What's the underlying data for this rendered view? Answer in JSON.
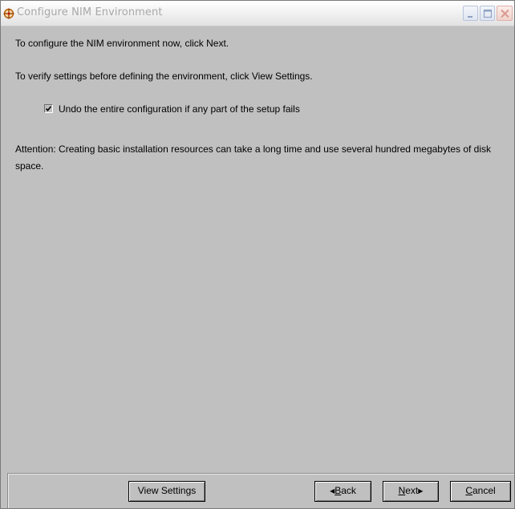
{
  "window": {
    "title": "Configure NIM Environment"
  },
  "content": {
    "line1": "To configure the NIM environment now, click Next.",
    "line2": "To verify settings before defining the environment,  click View Settings.",
    "checkbox": {
      "label": "Undo the entire configuration if any part of the setup fails",
      "checked": true
    },
    "attention": "Attention:  Creating basic installation resources can take a long time and use several hundred megabytes of disk space."
  },
  "buttons": {
    "view_settings": "View Settings",
    "back": {
      "arrow": "◀",
      "mnemonic": "B",
      "rest": "ack"
    },
    "next": {
      "mnemonic": "N",
      "rest": "ext",
      "arrow": "▶"
    },
    "cancel": {
      "mnemonic": "C",
      "rest": "ancel"
    }
  },
  "icons": {
    "app": "crosshair-compass-icon",
    "minimize": "minimize-icon",
    "maximize": "maximize-icon",
    "close": "close-icon",
    "check": "checkmark-icon"
  },
  "colors": {
    "window_bg": "#c0c0c0",
    "title_text": "#a8a8a8",
    "app_icon": "#b35a00"
  }
}
